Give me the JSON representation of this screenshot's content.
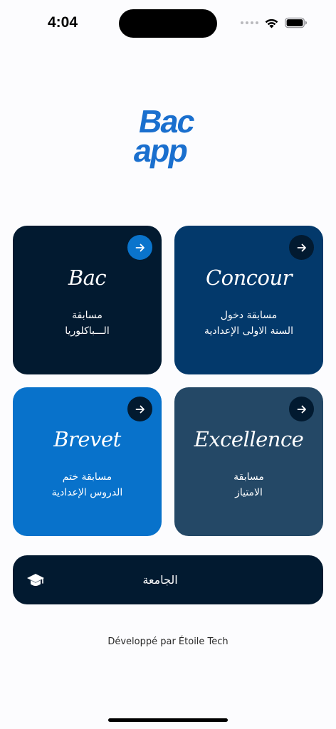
{
  "status_bar": {
    "time": "4:04"
  },
  "logo": {
    "line1": "Bac",
    "line2": "app",
    "brand_color": "#1a6fce",
    "dark_color": "#061a32"
  },
  "cards": [
    {
      "title": "Bac",
      "sub_line1": "مسابقة",
      "sub_line2": "الـــباكلوريا",
      "bg": "#021a30",
      "arrow_bg": "#0a74cc",
      "arrow_icon": "arrow-right-icon"
    },
    {
      "title": "Concour",
      "sub_line1": "مسابقة دخول",
      "sub_line2": "السنة الاولى الإعدادية",
      "bg": "#03396b",
      "arrow_bg": "#021a30",
      "arrow_icon": "arrow-right-icon"
    },
    {
      "title": "Brevet",
      "sub_line1": "مسابقة ختم",
      "sub_line2": "الدروس الإعدادية",
      "bg": "#0872cb",
      "arrow_bg": "#021a30",
      "arrow_icon": "arrow-right-icon"
    },
    {
      "title": "Excellence",
      "sub_line1": "مسابقة",
      "sub_line2": "الامتياز",
      "bg": "#244866",
      "arrow_bg": "#021a30",
      "arrow_icon": "arrow-right-icon"
    }
  ],
  "university": {
    "label": "الجامعة",
    "icon": "graduation-cap-icon",
    "bg": "#021a30"
  },
  "footer": {
    "text": "Développé par Étoile Tech"
  }
}
